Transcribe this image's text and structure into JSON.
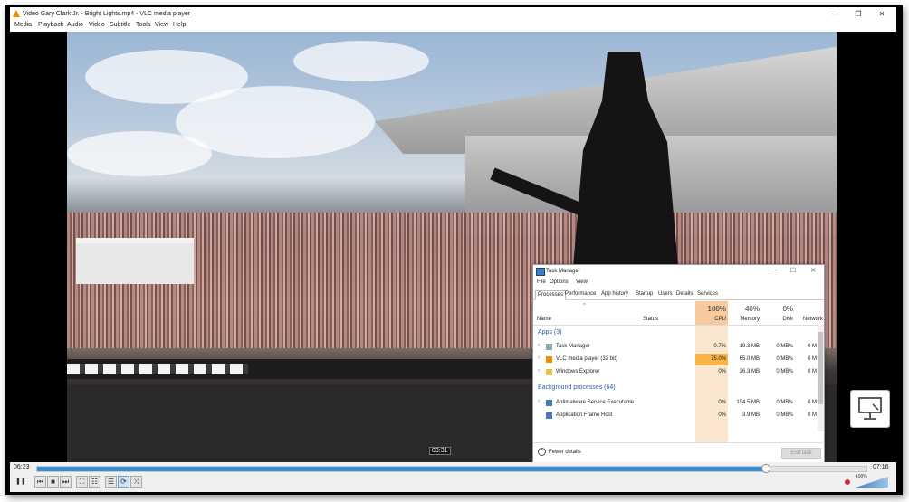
{
  "window": {
    "title": "Video Gary Clark Jr. - Bright Lights.mp4 - VLC media player",
    "minimize": "—",
    "restore": "❐",
    "close": "✕"
  },
  "menu": [
    "Media",
    "Playback",
    "Audio",
    "Video",
    "Subtitle",
    "Tools",
    "View",
    "Help"
  ],
  "player": {
    "current_time": "06:23",
    "total_time": "07:16",
    "hover_time": "03:31",
    "progress": 0.878,
    "volume_label": "100%",
    "volume_level": 1.0,
    "buttons": {
      "pause": "❚❚",
      "prev": "⏮",
      "stop": "■",
      "next": "⏭",
      "fullscreen": "⛶",
      "ext_settings": "☷",
      "playlist": "☰",
      "loop": "⟳",
      "shuffle": "⤨"
    }
  },
  "task_manager": {
    "title": "Task Manager",
    "controls": {
      "minimize": "—",
      "maximize": "☐",
      "close": "✕"
    },
    "menu": [
      "File",
      "Options",
      "View"
    ],
    "tabs": [
      "Processes",
      "Performance",
      "App history",
      "Startup",
      "Users",
      "Details",
      "Services"
    ],
    "sort_arrow": "^",
    "columns": {
      "name": "Name",
      "status": "Status",
      "cpu_pct": "100%",
      "cpu": "CPU",
      "memory_pct": "40%",
      "memory": "Memory",
      "disk_pct": "0%",
      "disk": "Disk",
      "network": "Network"
    },
    "groups": {
      "apps": "Apps (3)",
      "background": "Background processes (64)"
    },
    "apps": [
      {
        "name": "Task Manager",
        "cpu": "0.7%",
        "memory": "19.3 MB",
        "disk": "0 MB/s",
        "network": "0 M"
      },
      {
        "name": "VLC media player (32 bit)",
        "cpu": "75.0%",
        "memory": "65.0 MB",
        "disk": "0 MB/s",
        "network": "0 M"
      },
      {
        "name": "Windows Explorer",
        "cpu": "0%",
        "memory": "26.3 MB",
        "disk": "0 MB/s",
        "network": "0 M"
      }
    ],
    "background": [
      {
        "name": "Antimalware Service Executable",
        "cpu": "0%",
        "memory": "194.5 MB",
        "disk": "0 MB/s",
        "network": "0 M"
      },
      {
        "name": "Application Frame Host",
        "cpu": "0%",
        "memory": "3.9 MB",
        "disk": "0 MB/s",
        "network": "0 M"
      }
    ],
    "fewer_details": "Fewer details",
    "end_task": "End task",
    "colors": {
      "cpu_high": "#f8b448",
      "cpu_col": "#fbe7cf"
    }
  }
}
